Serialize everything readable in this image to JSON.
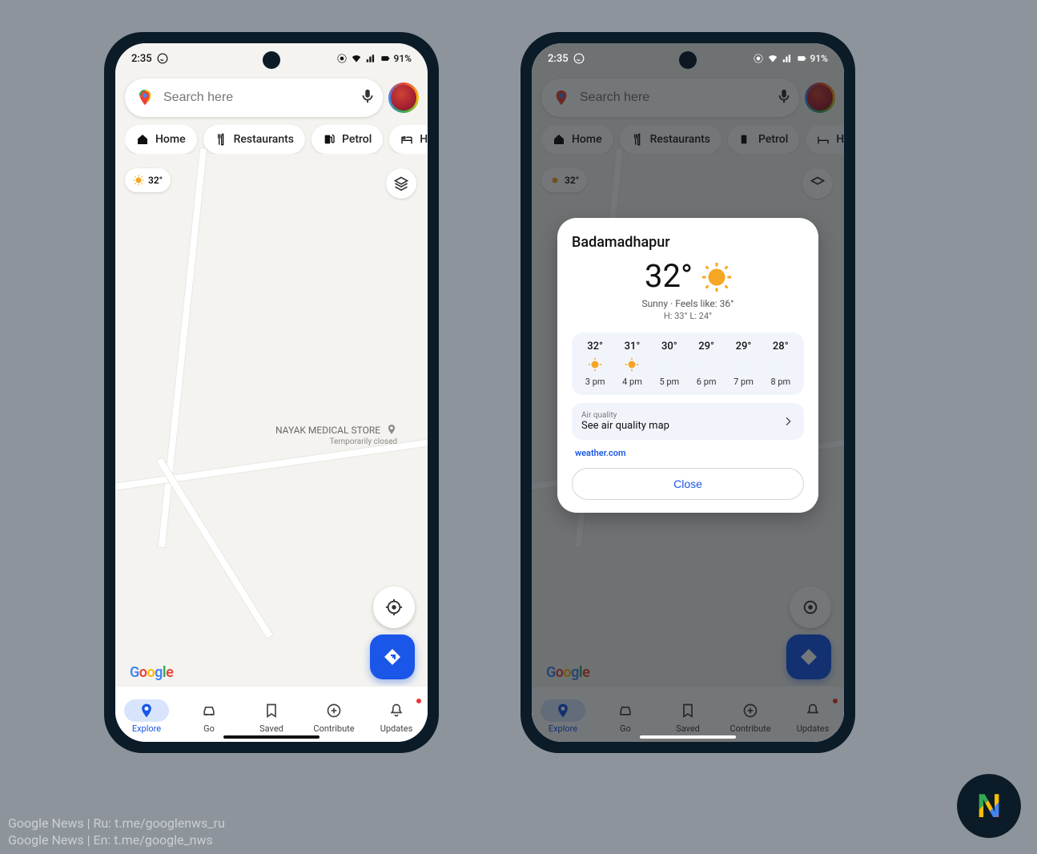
{
  "status": {
    "time": "2:35",
    "battery": "91%"
  },
  "search": {
    "placeholder": "Search here"
  },
  "chips": [
    {
      "label": "Home",
      "icon": "home"
    },
    {
      "label": "Restaurants",
      "icon": "restaurant"
    },
    {
      "label": "Petrol",
      "icon": "fuel"
    },
    {
      "label": "Hotels",
      "icon": "hotel"
    }
  ],
  "map_weather_chip": "32°",
  "place": {
    "name": "NAYAK MEDICAL STORE",
    "status": "Temporarily closed"
  },
  "logo_text": "Google",
  "nav": [
    {
      "label": "Explore",
      "active": true
    },
    {
      "label": "Go",
      "active": false
    },
    {
      "label": "Saved",
      "active": false
    },
    {
      "label": "Contribute",
      "active": false
    },
    {
      "label": "Updates",
      "active": false
    }
  ],
  "weather_card": {
    "location": "Badamadhapur",
    "temp": "32°",
    "summary": "Sunny · Feels like: 36°",
    "hilo": "H: 33° L: 24°",
    "forecast": [
      {
        "temp": "32°",
        "time": "3 pm",
        "icon": "sun"
      },
      {
        "temp": "31°",
        "time": "4 pm",
        "icon": "sun"
      },
      {
        "temp": "30°",
        "time": "5 pm",
        "icon": "moon"
      },
      {
        "temp": "29°",
        "time": "6 pm",
        "icon": "moon"
      },
      {
        "temp": "29°",
        "time": "7 pm",
        "icon": "moon"
      },
      {
        "temp": "28°",
        "time": "8 pm",
        "icon": "moon"
      }
    ],
    "aq_label": "Air quality",
    "aq_value": "See air quality map",
    "source": "weather.com",
    "close": "Close"
  },
  "watermark": {
    "line1": "Google News | Ru: t.me/googlenws_ru",
    "line2": "Google News | En: t.me/google_nws"
  },
  "corner_logo": "N"
}
